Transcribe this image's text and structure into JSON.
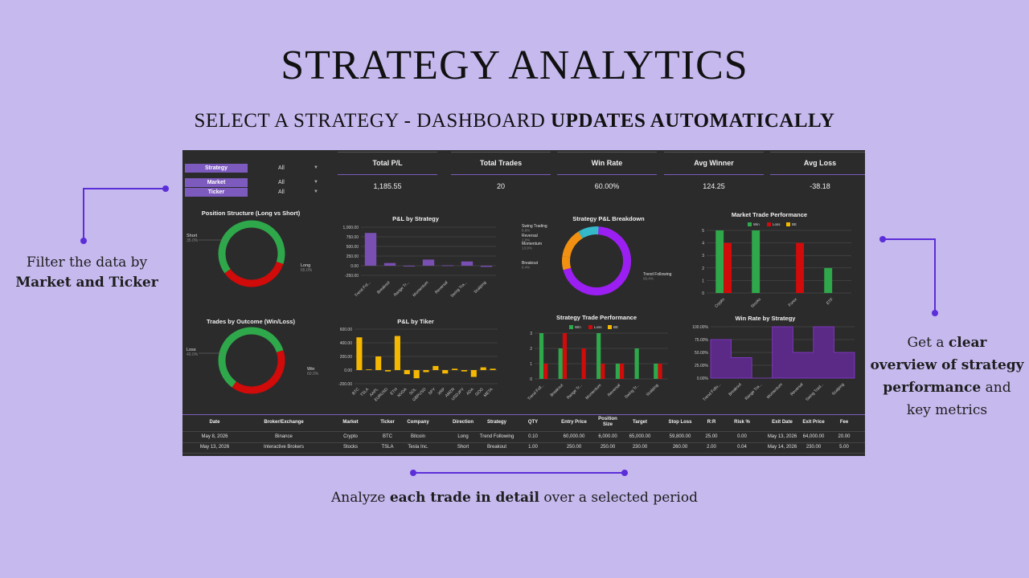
{
  "page": {
    "title": "STRATEGY ANALYTICS",
    "subtitle_plain": "SELECT A STRATEGY - DASHBOARD ",
    "subtitle_bold": "UPDATES AUTOMATICALLY"
  },
  "notes": {
    "left_line1": "Filter the data by",
    "left_bold": "Market and Ticker",
    "right_line1_plain": "Get a ",
    "right_line1_bold": "clear",
    "right_line2_bold": "overview of strategy",
    "right_line3_bold": "performance",
    "right_line3_plain": " and",
    "right_line4": "key metrics",
    "bottom_plain1": "Analyze ",
    "bottom_bold": "each trade in detail",
    "bottom_plain2": " over a selected period"
  },
  "colors": {
    "accent": "#7d5bbe",
    "win": "#2ea84a",
    "loss": "#d10a0a",
    "be": "#f5b800",
    "purple": "#9b1ff2",
    "teal": "#35b8c9",
    "orange": "#f29111",
    "background": "#c6b9ee",
    "panel": "#2b2b2b"
  },
  "filters": [
    {
      "label": "Strategy",
      "value": "All"
    },
    {
      "label": "Market",
      "value": "All"
    },
    {
      "label": "Ticker",
      "value": "All"
    }
  ],
  "kpis": [
    {
      "label": "Total P/L",
      "value": "1,185.55"
    },
    {
      "label": "Total Trades",
      "value": "20"
    },
    {
      "label": "Win Rate",
      "value": "60.00%"
    },
    {
      "label": "Avg Winner",
      "value": "124.25"
    },
    {
      "label": "Avg Loss",
      "value": "-38.18"
    }
  ],
  "chart_data": [
    {
      "id": "position-structure",
      "type": "pie",
      "title": "Position Structure (Long vs Short)",
      "labels": [
        "Long",
        "Short"
      ],
      "values": [
        65.0,
        35.0
      ],
      "display_values": [
        "65.0%",
        "35.0%"
      ]
    },
    {
      "id": "trades-by-outcome",
      "type": "pie",
      "title": "Trades by Outcome (Win/Loss)",
      "labels": [
        "Win",
        "Loss"
      ],
      "values": [
        60.0,
        40.0
      ],
      "display_values": [
        "60.0%",
        "40.0%"
      ]
    },
    {
      "id": "pnl-by-strategy",
      "type": "bar",
      "title": "P&L by Strategy",
      "categories": [
        "Trend Fol...",
        "Breakout",
        "Range Tr...",
        "Momentum",
        "Reversal",
        "Swing Tra...",
        "Scalping"
      ],
      "values": [
        850,
        70,
        -20,
        160,
        10,
        110,
        -30
      ],
      "ylim": [
        -250,
        1000
      ],
      "yticks": [
        "1,000.00",
        "750.00",
        "500.00",
        "250.00",
        "0.00",
        "-250.00"
      ]
    },
    {
      "id": "pnl-by-ticker",
      "type": "bar",
      "title": "P&L by Tiker",
      "categories": [
        "BTC",
        "TSLA",
        "AAPL",
        "EURUSD",
        "ETH",
        "NVDA",
        "SOL",
        "GBPUSD",
        "SPY",
        "XRP",
        "AMZN",
        "USDJPY",
        "ADA",
        "GOG",
        "META"
      ],
      "values": [
        480,
        10,
        200,
        -20,
        500,
        -60,
        -120,
        -30,
        60,
        -50,
        20,
        -20,
        -100,
        40,
        20
      ],
      "ylim": [
        -200,
        600
      ],
      "yticks": [
        "600.00",
        "400.00",
        "200.00",
        "0.00",
        "-200.00"
      ]
    },
    {
      "id": "strategy-pnl-breakdown",
      "type": "pie",
      "title": "Strategy P&L Breakdown",
      "labels": [
        "Trend Following",
        "Breakout",
        "Momentum",
        "Reversal",
        "Swing Trading"
      ],
      "values": [
        69.4,
        6.4,
        13.9,
        1.0,
        8.8
      ],
      "display_values": [
        "69.4%",
        "6.4%",
        "13.9%",
        "1.0%",
        "8.8%"
      ]
    },
    {
      "id": "market-trade-performance",
      "type": "bar",
      "title": "Market Trade Performance",
      "categories": [
        "Crypto",
        "Stocks",
        "Forex",
        "ETF"
      ],
      "series": [
        {
          "name": "Win",
          "values": [
            5,
            5,
            0,
            2
          ]
        },
        {
          "name": "Loss",
          "values": [
            4,
            0,
            4,
            0
          ]
        },
        {
          "name": "BE",
          "values": [
            0,
            0,
            0,
            0
          ]
        }
      ],
      "ylim": [
        0,
        5
      ],
      "yticks": [
        "5",
        "4",
        "3",
        "2",
        "1",
        "0"
      ]
    },
    {
      "id": "strategy-trade-performance",
      "type": "bar",
      "title": "Strategy Trade Performance",
      "categories": [
        "Trend Foll...",
        "Breakout",
        "Range Tr...",
        "Momentum",
        "Reversal",
        "Swing Tr...",
        "Scalping"
      ],
      "series": [
        {
          "name": "Win",
          "values": [
            3,
            2,
            0,
            3,
            1,
            2,
            1
          ]
        },
        {
          "name": "Loss",
          "values": [
            1,
            3,
            2,
            1,
            1,
            0,
            1
          ]
        },
        {
          "name": "BE",
          "values": [
            0,
            0,
            0,
            0,
            0,
            0,
            0
          ]
        }
      ],
      "ylim": [
        0,
        3
      ],
      "yticks": [
        "3",
        "2",
        "1",
        "0"
      ]
    },
    {
      "id": "win-rate-by-strategy",
      "type": "area",
      "title": "Win Rate by Strategy",
      "categories": [
        "Trend Follo...",
        "Breakout",
        "Range Tra...",
        "Momentum",
        "Reversal",
        "Swing Trad...",
        "Scalping"
      ],
      "values": [
        75,
        40,
        0,
        100,
        50,
        100,
        50
      ],
      "ylim": [
        0,
        100
      ],
      "yticks": [
        "100.00%",
        "75.00%",
        "50.00%",
        "25.00%",
        "0.00%"
      ]
    }
  ],
  "table": {
    "headers": [
      "Date",
      "Broker/Exchange",
      "Market",
      "Ticker",
      "Company",
      "Direction",
      "Strategy",
      "QTY",
      "Entry Price",
      "Position Size",
      "Target",
      "Stop Loss",
      "R:R",
      "Risk %",
      "Exit Date",
      "Exit Price",
      "Fee"
    ],
    "rows": [
      [
        "May 8, 2026",
        "Binance",
        "Crypto",
        "BTC",
        "Bitcoin",
        "Long",
        "Trend Following",
        "0.10",
        "60,000.00",
        "6,000.00",
        "65,000.00",
        "59,800.00",
        "25.00",
        "0.00",
        "May 13, 2026",
        "64,000.00",
        "20.00"
      ],
      [
        "May 13, 2026",
        "Interactive Brokers",
        "Stocks",
        "TSLA",
        "Tesla Inc.",
        "Short",
        "Breakout",
        "1.00",
        "250.00",
        "250.00",
        "230.00",
        "260.00",
        "2.00",
        "0.04",
        "May 14, 2026",
        "230.00",
        "5.00"
      ]
    ]
  }
}
